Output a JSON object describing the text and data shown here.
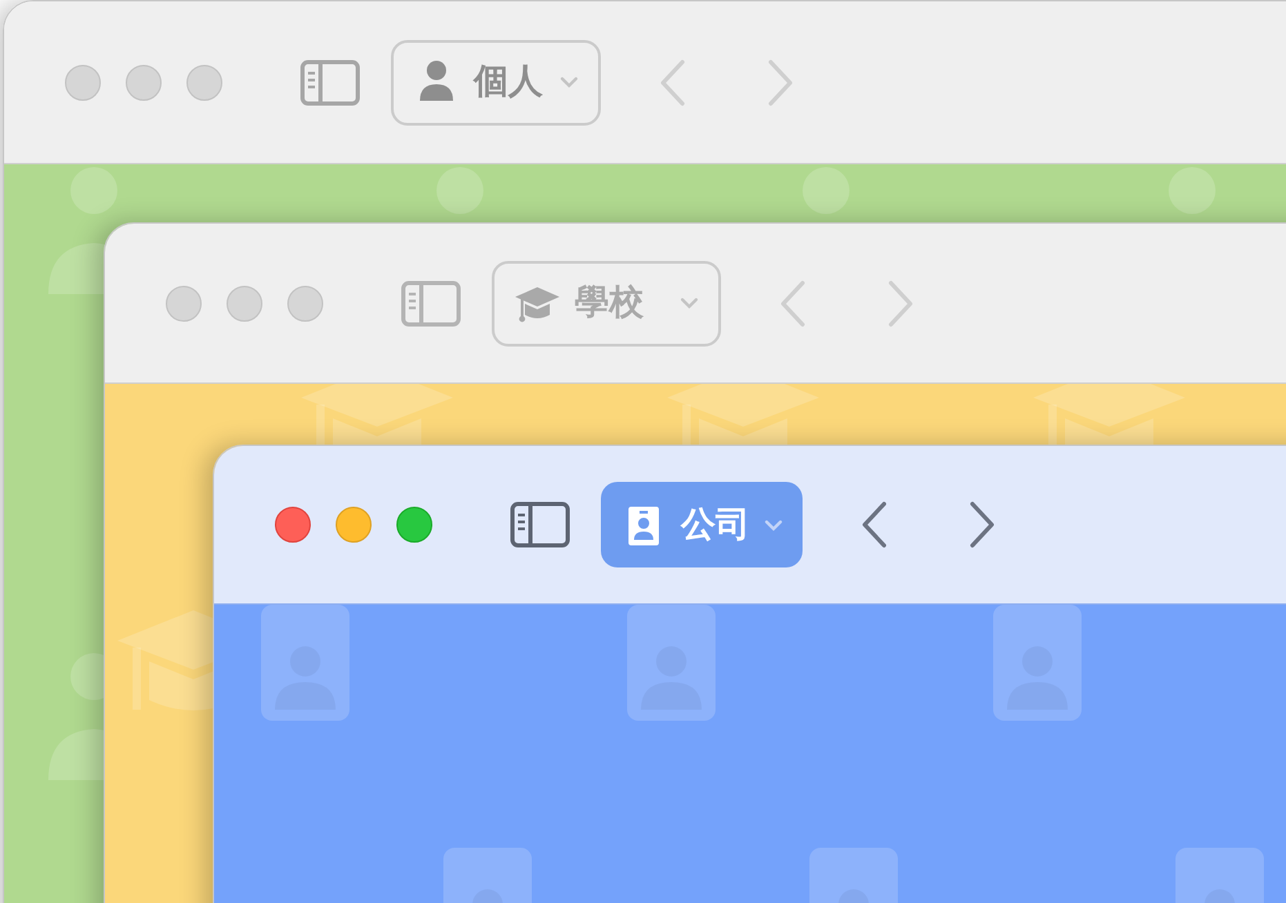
{
  "windows": [
    {
      "profile": "個人",
      "kind": "person",
      "active": false,
      "color": "#b0d98f"
    },
    {
      "profile": "學校",
      "kind": "graduation",
      "active": false,
      "color": "#fbd77a"
    },
    {
      "profile": "公司",
      "kind": "badge",
      "active": true,
      "color": "#74a2fb"
    }
  ]
}
